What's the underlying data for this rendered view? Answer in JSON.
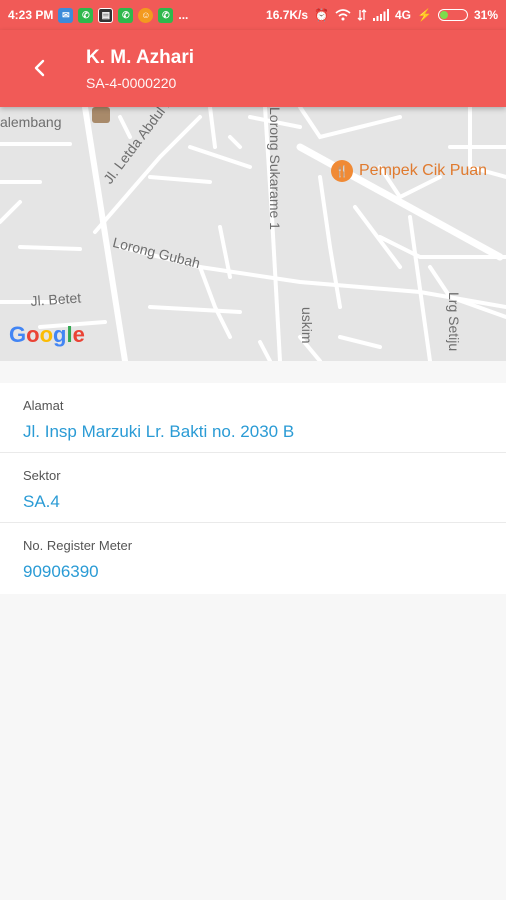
{
  "status_bar": {
    "time": "4:23 PM",
    "notifications": [
      "mail-icon",
      "whatsapp-icon",
      "chat-icon",
      "whatsapp-icon",
      "vpn-icon",
      "whatsapp-icon"
    ],
    "more": "...",
    "net_speed": "16.7K/s",
    "network_type": "4G",
    "battery": "31%",
    "battery_level": 0.31
  },
  "app_bar": {
    "title": "K. M. Azhari",
    "subtitle": "SA-4-0000220"
  },
  "map": {
    "labels": {
      "l1": "Jl. Letda Abdul Ro",
      "l2": "Lorong Sukarame 1",
      "l3": "Lorong Gubah",
      "l4": "Jl. Betet",
      "l5": "alembang",
      "l6": "uskim",
      "l7": "Lrg Setiju"
    },
    "poi": "Pempek Cik Puan",
    "google": [
      "G",
      "o",
      "o",
      "g",
      "l",
      "e"
    ],
    "colors": {
      "background": "#e5e5e5",
      "road": "#ffffff",
      "label": "#6e6e6e",
      "poi": "#f08a35"
    }
  },
  "details": [
    {
      "label": "Alamat",
      "value": "Jl. Insp Marzuki Lr. Bakti no. 2030 B"
    },
    {
      "label": "Sektor",
      "value": "SA.4"
    },
    {
      "label": "No. Register Meter",
      "value": "90906390"
    }
  ],
  "colors": {
    "primary": "#f15a57",
    "link": "#2a9bd5",
    "background": "#f7f7f7"
  }
}
